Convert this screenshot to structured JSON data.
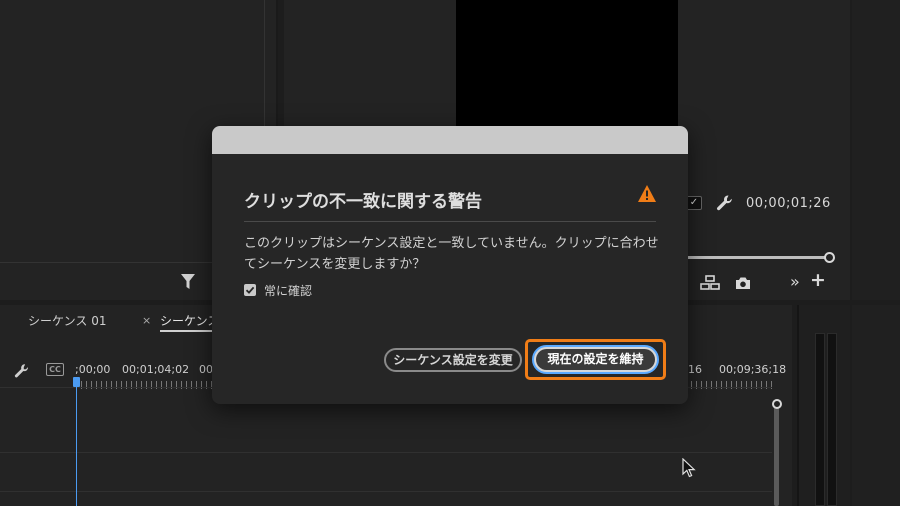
{
  "timeline": {
    "tabs": [
      {
        "label": "シーケンス 01"
      },
      {
        "close_glyph": "×",
        "label": "シーケンス"
      }
    ],
    "timecodes": [
      ";00;00",
      "00;01;04;02",
      "00",
      "16",
      "00;09;36;18"
    ],
    "cc_label": "CC"
  },
  "monitor": {
    "timecode": "00;00;01;26",
    "checkbox_glyph": "✓",
    "more_glyph": "»",
    "plus_glyph": "+"
  },
  "dialog": {
    "title": "クリップの不一致に関する警告",
    "message": "このクリップはシーケンス設定と一致していません。クリップに合わせてシーケンスを変更しますか？",
    "always_check_label": "常に確認",
    "always_check_checked": true,
    "buttons": {
      "change_sequence": "シーケンス設定を変更",
      "keep_settings": "現在の設定を維持"
    }
  },
  "colors": {
    "highlight": "#f07d17",
    "focus_ring": "#5aa9ff",
    "playhead": "#4b9bf2",
    "warning": "#f07d17"
  }
}
